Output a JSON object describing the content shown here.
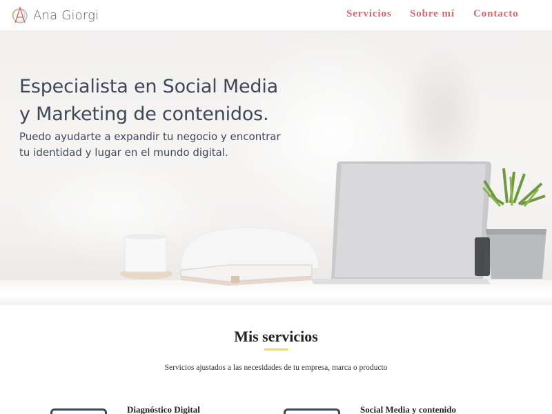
{
  "brand": {
    "name": "Ana Giorgi",
    "logo_icon": "letter-a-circle-logo"
  },
  "nav": {
    "items": [
      {
        "label": "Servicios"
      },
      {
        "label": "Sobre mí"
      },
      {
        "label": "Contacto"
      }
    ],
    "color": "#e2616a"
  },
  "hero": {
    "title_line1": "Especialista en Social Media",
    "title_line2": "y Marketing de contenidos.",
    "subtitle_line1": "Puedo ayudarte a expandir tu negocio y encontrar",
    "subtitle_line2": "tu identidad y lugar en el mundo digital."
  },
  "services": {
    "title": "Mis servicios",
    "subtitle": "Servicios ajustados a las necesidades de tu empresa, marca o producto",
    "accent": "#e8e23a",
    "cards": [
      {
        "title": "Diagnóstico Digital",
        "icon": "monitor-icon"
      },
      {
        "title": "Social Media y contenido",
        "icon": "monitor-icon"
      }
    ]
  }
}
